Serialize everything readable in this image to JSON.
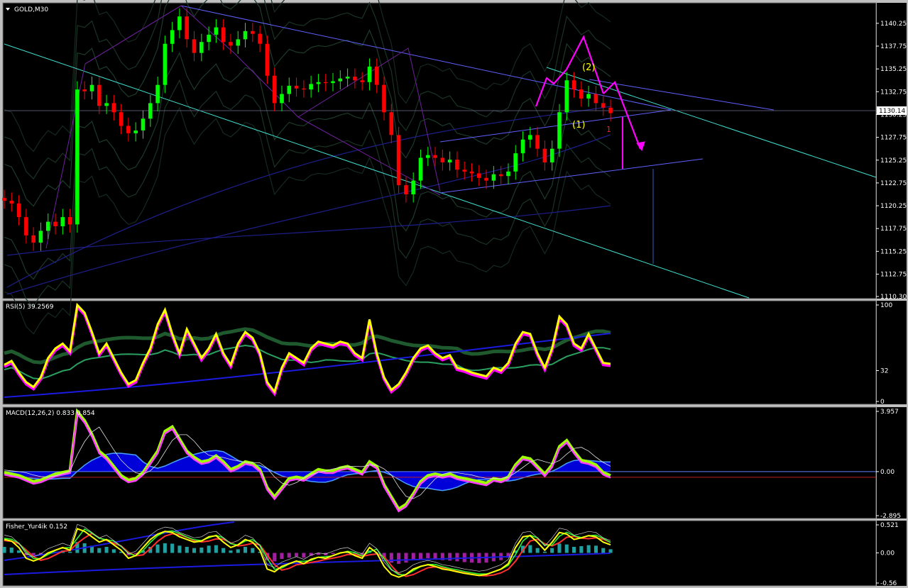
{
  "window": {
    "symbol_label": "GOLD,M30"
  },
  "colors": {
    "background": "#000000",
    "frame": "#c0c0c0",
    "bull_candle": "#00ff00",
    "bear_candle": "#ff0000",
    "rsi_line": "#ffff00",
    "rsi_shadow": "#ff00ff",
    "macd_hist": "#0000ff",
    "wave_arrows": "#ff00ff",
    "channel": "#6060ff",
    "trend_cyan": "#40e0d0",
    "wave_label": "#ffff00"
  },
  "chart_data": [
    {
      "type": "candlestick",
      "panel": "price",
      "title": "GOLD,M30",
      "ylim": [
        1110.3,
        1141.25
      ],
      "yticks": [
        "1140.25",
        "1137.75",
        "1135.25",
        "1132.75",
        "1130.25",
        "1127.75",
        "1125.25",
        "1122.75",
        "1120.25",
        "1117.75",
        "1115.25",
        "1112.75",
        "1110.30"
      ],
      "current_price": "1130.14",
      "current_value": 1130.14,
      "wave_labels": [
        "(2)",
        "(1)",
        "1"
      ],
      "close_path": [
        1120.8,
        1120.5,
        1119.0,
        1117.0,
        1116.2,
        1117.5,
        1118.5,
        1118.0,
        1119.0,
        1118.2,
        1133.0,
        1132.8,
        1133.5,
        1131.2,
        1131.5,
        1130.5,
        1129.0,
        1128.2,
        1128.5,
        1129.8,
        1131.5,
        1133.5,
        1138.0,
        1139.5,
        1141.0,
        1138.5,
        1137.0,
        1138.2,
        1139.0,
        1139.8,
        1138.2,
        1137.8,
        1138.5,
        1139.4,
        1139.1,
        1138.0,
        1134.5,
        1131.5,
        1132.5,
        1133.4,
        1133.1,
        1133.0,
        1133.6,
        1133.8,
        1133.7,
        1133.9,
        1134.2,
        1134.4,
        1134.0,
        1133.8,
        1135.5,
        1133.5,
        1130.5,
        1128.0,
        1122.5,
        1121.5,
        1123.0,
        1125.5,
        1125.8,
        1125.5,
        1125.0,
        1125.3,
        1124.2,
        1124.0,
        1123.8,
        1123.3,
        1123.0,
        1123.7,
        1123.5,
        1124.0,
        1126.0,
        1127.5,
        1128.0,
        1126.5,
        1125.0,
        1126.5,
        1130.5,
        1134.0,
        1133.0,
        1132.0,
        1132.5,
        1131.5,
        1131.0,
        1130.4
      ]
    },
    {
      "type": "line",
      "panel": "rsi",
      "title": "RSI(5) 39.2569",
      "ylim": [
        0,
        100
      ],
      "yticks": [
        "100",
        "32",
        "0"
      ],
      "values": [
        38,
        42,
        30,
        20,
        15,
        25,
        45,
        55,
        60,
        52,
        100,
        92,
        72,
        50,
        60,
        45,
        30,
        18,
        22,
        40,
        55,
        80,
        95,
        70,
        50,
        75,
        60,
        45,
        55,
        70,
        50,
        38,
        60,
        72,
        66,
        50,
        20,
        10,
        35,
        50,
        45,
        40,
        55,
        62,
        60,
        58,
        62,
        60,
        50,
        45,
        85,
        50,
        25,
        12,
        18,
        30,
        45,
        55,
        58,
        50,
        45,
        48,
        35,
        33,
        30,
        28,
        26,
        35,
        32,
        40,
        60,
        72,
        70,
        50,
        35,
        55,
        88,
        80,
        60,
        55,
        70,
        55,
        40,
        39
      ]
    },
    {
      "type": "line",
      "panel": "macd",
      "title": "MACD(12,26,2) 0.833 0.854",
      "ylim": [
        -2.895,
        3.957
      ],
      "yticks": [
        "3.957",
        "0.00",
        "-2.895"
      ],
      "values": [
        -0.2,
        -0.3,
        -0.4,
        -0.6,
        -0.8,
        -0.7,
        -0.5,
        -0.3,
        -0.2,
        -0.1,
        3.8,
        3.2,
        2.3,
        1.2,
        0.8,
        0.2,
        -0.4,
        -0.7,
        -0.6,
        -0.2,
        0.5,
        1.2,
        2.5,
        2.8,
        2.0,
        1.2,
        0.8,
        0.5,
        0.6,
        0.9,
        0.5,
        0.0,
        0.2,
        0.5,
        0.4,
        0.0,
        -1.2,
        -1.8,
        -1.2,
        -0.6,
        -0.5,
        -0.6,
        -0.3,
        0.0,
        -0.1,
        -0.1,
        0.1,
        0.2,
        0.0,
        -0.2,
        0.5,
        0.2,
        -1.0,
        -1.8,
        -2.6,
        -2.3,
        -1.6,
        -0.8,
        -0.4,
        -0.3,
        -0.4,
        -0.3,
        -0.5,
        -0.6,
        -0.7,
        -0.8,
        -0.9,
        -0.6,
        -0.7,
        -0.5,
        0.3,
        0.8,
        0.7,
        0.2,
        -0.3,
        0.3,
        1.5,
        1.9,
        1.2,
        0.6,
        0.5,
        0.3,
        -0.2,
        -0.4
      ]
    },
    {
      "type": "line",
      "panel": "fisher",
      "title": "Fisher_Yur4ik 0.152",
      "ylim": [
        -0.56,
        0.521
      ],
      "yticks": [
        "0.521",
        "0.00",
        "-0.56"
      ],
      "values": [
        0.25,
        0.22,
        0.1,
        -0.1,
        -0.15,
        -0.1,
        0.0,
        0.05,
        0.1,
        0.05,
        0.45,
        0.4,
        0.3,
        0.2,
        0.25,
        0.15,
        0.05,
        -0.1,
        -0.05,
        0.1,
        0.25,
        0.35,
        0.4,
        0.38,
        0.3,
        0.25,
        0.2,
        0.22,
        0.3,
        0.32,
        0.2,
        0.1,
        0.15,
        0.25,
        0.2,
        0.05,
        -0.3,
        -0.35,
        -0.25,
        -0.2,
        -0.15,
        -0.2,
        -0.12,
        -0.08,
        -0.1,
        -0.05,
        0.0,
        0.02,
        -0.05,
        -0.1,
        0.1,
        0.0,
        -0.25,
        -0.4,
        -0.45,
        -0.4,
        -0.3,
        -0.25,
        -0.22,
        -0.25,
        -0.3,
        -0.32,
        -0.35,
        -0.38,
        -0.4,
        -0.42,
        -0.4,
        -0.35,
        -0.3,
        -0.2,
        0.1,
        0.3,
        0.32,
        0.2,
        0.05,
        0.2,
        0.38,
        0.35,
        0.25,
        0.28,
        0.32,
        0.3,
        0.2,
        0.15
      ]
    }
  ]
}
